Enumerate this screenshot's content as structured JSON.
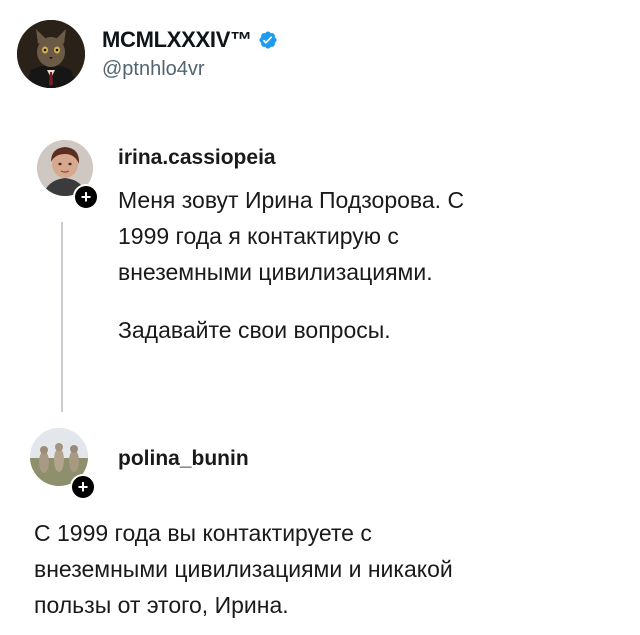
{
  "header": {
    "name": "MCMLXXXIV™",
    "handle": "@ptnhlo4vr",
    "verified_color": "#1d9bf0"
  },
  "posts": [
    {
      "username": "irina.cassiopeia",
      "lines": [
        "Меня зовут Ирина Подзорова. С",
        "1999 года я контактирую с",
        "внеземными цивилизациями."
      ],
      "paragraph2": "Задавайте свои вопросы.",
      "badge": "+"
    },
    {
      "username": "polina_bunin",
      "lines": [
        "С 1999 года вы контактируете с",
        "внеземными цивилизациями и никакой",
        "пользы от этого, Ирина."
      ],
      "badge": "+"
    }
  ]
}
